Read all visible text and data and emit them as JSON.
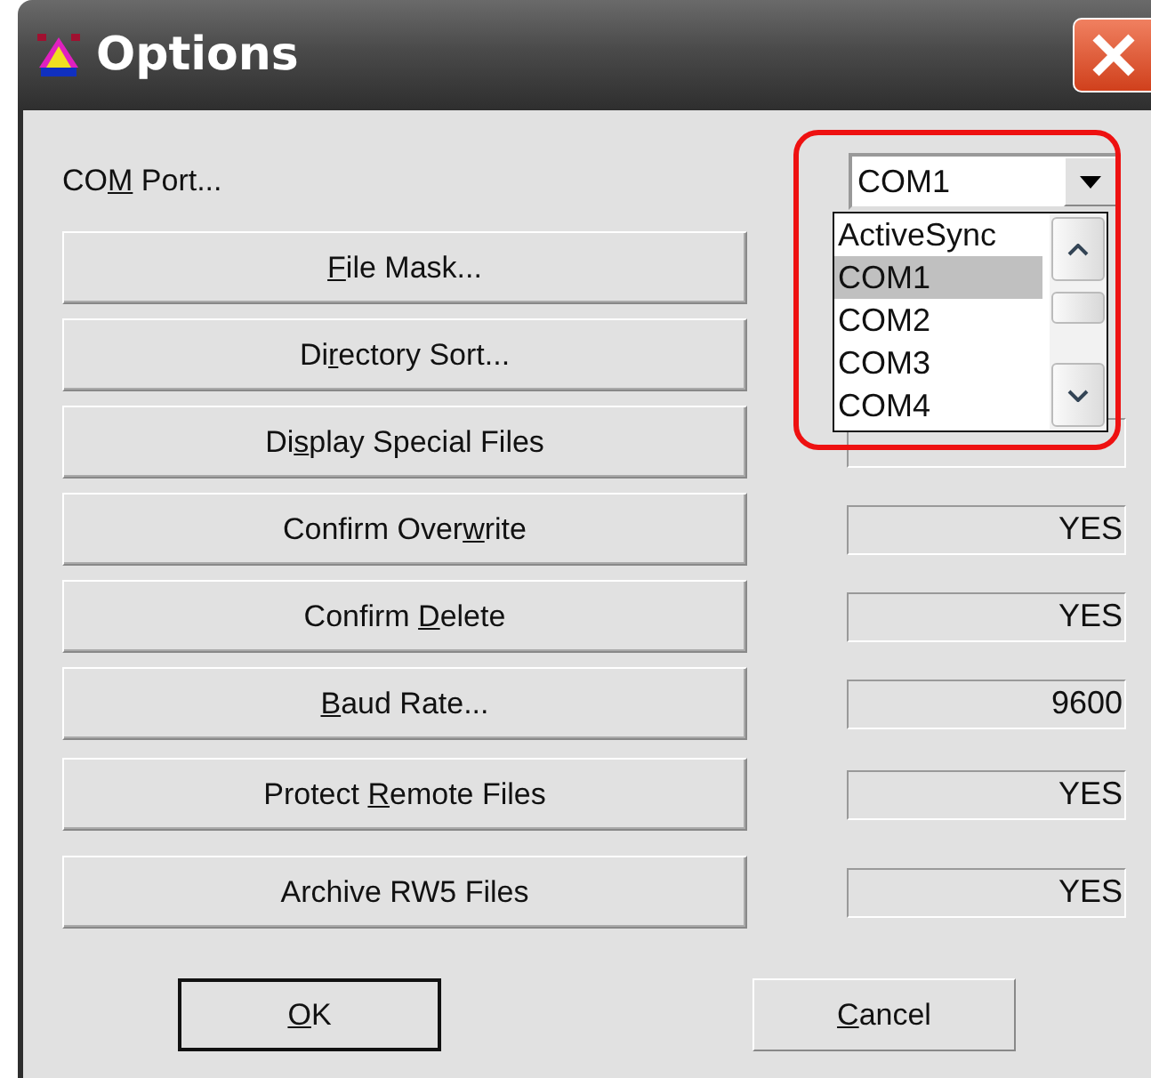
{
  "window": {
    "title": "Options"
  },
  "com_port": {
    "label": {
      "pre": "CO",
      "key": "M",
      "post": " Port..."
    },
    "value": "COM1",
    "expanded": true,
    "options": [
      {
        "label": "ActiveSync",
        "selected": false
      },
      {
        "label": "COM1",
        "selected": true
      },
      {
        "label": "COM2",
        "selected": false
      },
      {
        "label": "COM3",
        "selected": false
      },
      {
        "label": "COM4",
        "selected": false
      }
    ]
  },
  "settings": [
    {
      "label": {
        "key": "F",
        "post": "ile Mask..."
      }
    },
    {
      "label": {
        "pre": "Di",
        "key": "r",
        "post": "ectory Sort..."
      }
    },
    {
      "label": {
        "pre": "Di",
        "key": "s",
        "post": "play Special Files"
      },
      "field": true
    },
    {
      "label": {
        "pre": "Confirm Over",
        "key": "w",
        "post": "rite"
      },
      "value": "YES"
    },
    {
      "label": {
        "pre": "Confirm ",
        "key": "D",
        "post": "elete"
      },
      "value": "YES"
    },
    {
      "label": {
        "key": "B",
        "post": "aud Rate..."
      },
      "value": "9600"
    },
    {
      "label": {
        "pre": "Protect ",
        "key": "R",
        "post": "emote Files"
      },
      "value": "YES"
    },
    {
      "label": {
        "pre": "Archive RW5 Files"
      },
      "value": "YES"
    }
  ],
  "buttons": [
    {
      "label": {
        "key": "O",
        "post": "K"
      },
      "default": true
    },
    {
      "label": {
        "key": "C",
        "post": "ancel"
      },
      "default": false
    }
  ]
}
